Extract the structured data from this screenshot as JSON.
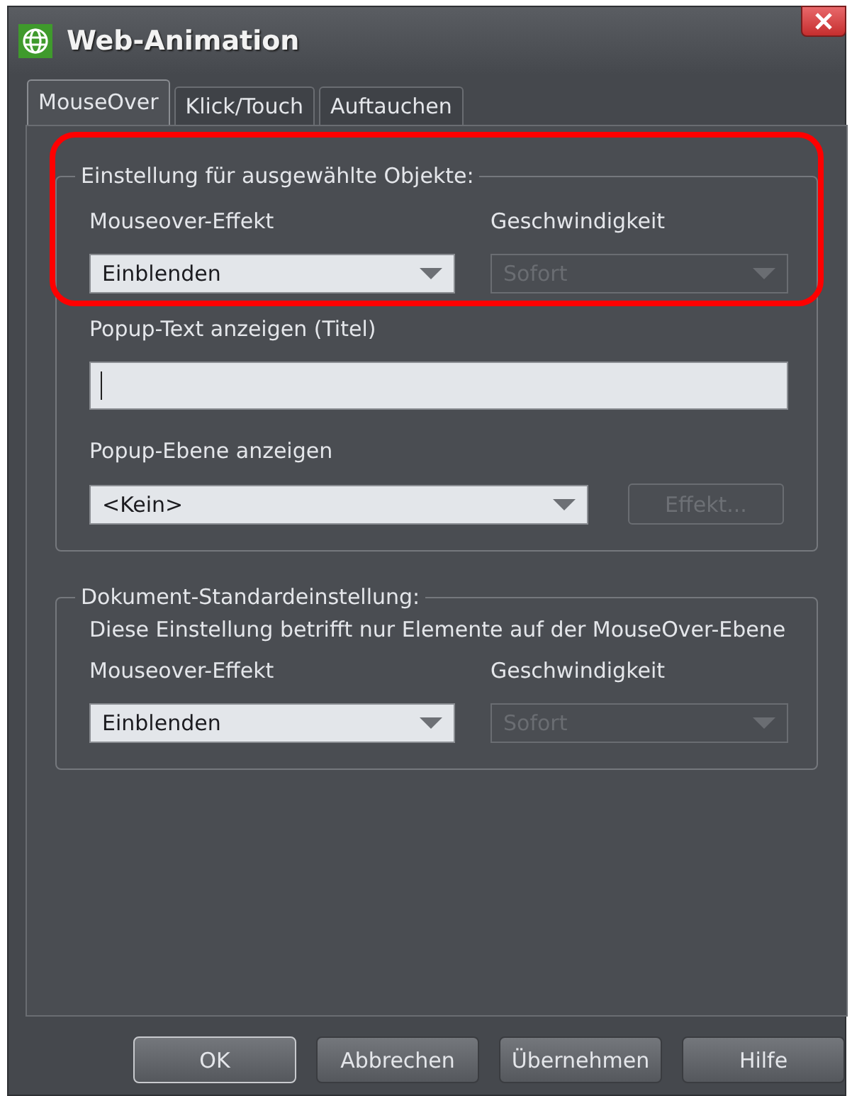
{
  "window": {
    "title": "Web-Animation"
  },
  "tabs": [
    {
      "label": "MouseOver",
      "selected": true
    },
    {
      "label": "Klick/Touch",
      "selected": false
    },
    {
      "label": "Auftauchen",
      "selected": false
    }
  ],
  "groups": [
    {
      "legend": "Einstellung für ausgewählte Objekte:",
      "highlighted": true,
      "items": [
        {
          "kind": "select-pair",
          "fields": [
            {
              "label": "Mouseover-Effekt",
              "value": "Einblenden",
              "disabled": false
            },
            {
              "label": "Geschwindigkeit",
              "value": "Sofort",
              "disabled": true
            }
          ]
        },
        {
          "kind": "text",
          "label": "Popup-Text anzeigen (Titel)",
          "value": "",
          "focused": true
        },
        {
          "kind": "select-button",
          "label": "Popup-Ebene anzeigen",
          "value": "<Kein>",
          "disabled": false,
          "button": {
            "label": "Effekt...",
            "disabled": true
          }
        }
      ]
    },
    {
      "legend": "Dokument-Standardeinstellung:",
      "highlighted": false,
      "items": [
        {
          "kind": "note",
          "text": "Diese Einstellung betrifft nur Elemente auf der MouseOver-Ebene"
        },
        {
          "kind": "select-pair",
          "fields": [
            {
              "label": "Mouseover-Effekt",
              "value": "Einblenden",
              "disabled": false
            },
            {
              "label": "Geschwindigkeit",
              "value": "Sofort",
              "disabled": true
            }
          ]
        }
      ]
    }
  ],
  "buttons": [
    {
      "label": "OK",
      "default": true
    },
    {
      "label": "Abbrechen",
      "default": false
    },
    {
      "label": "Übernehmen",
      "default": false
    },
    {
      "label": "Hilfe",
      "default": false
    }
  ]
}
